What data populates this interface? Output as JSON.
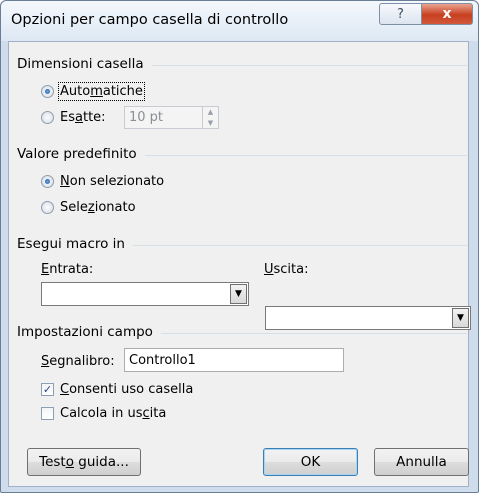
{
  "dialog": {
    "title": "Opzioni per campo casella di controllo",
    "help_label": "?",
    "close_label": "x"
  },
  "size_group": {
    "label": "Dimensioni casella",
    "auto": {
      "pre": "Auto",
      "acc": "m",
      "post": "atiche",
      "selected": true
    },
    "exact": {
      "pre": "Es",
      "acc": "a",
      "post": "tte:",
      "selected": false
    },
    "exact_value": "10 pt"
  },
  "default_group": {
    "label": "Valore predefinito",
    "not_selected": {
      "pre": "",
      "acc": "N",
      "post": "on selezionato",
      "selected": true
    },
    "selected_opt": {
      "pre": "Sele",
      "acc": "z",
      "post": "ionato",
      "selected": false
    }
  },
  "macro_group": {
    "label": "Esegui macro in",
    "entry_label": {
      "pre": "",
      "acc": "E",
      "post": "ntrata:"
    },
    "exit_label": {
      "pre": "",
      "acc": "U",
      "post": "scita:"
    },
    "entry_value": "",
    "exit_value": ""
  },
  "field_group": {
    "label": "Impostazioni campo",
    "bookmark_label": {
      "pre": "",
      "acc": "S",
      "post": "egnalibro:"
    },
    "bookmark_value": "Controllo1",
    "enable": {
      "pre": "",
      "acc": "C",
      "post": "onsenti uso casella",
      "checked": true
    },
    "calc": {
      "pre": "Calcola in us",
      "acc": "c",
      "post": "ita",
      "checked": false
    }
  },
  "buttons": {
    "help_text": {
      "pre": "Test",
      "acc": "o",
      "post": " guida..."
    },
    "ok": "OK",
    "cancel": "Annulla"
  },
  "icons": {
    "dropdown": "chevron-down-icon",
    "spin": "spinner-arrows-icon",
    "close": "close-icon",
    "help": "help-icon"
  }
}
